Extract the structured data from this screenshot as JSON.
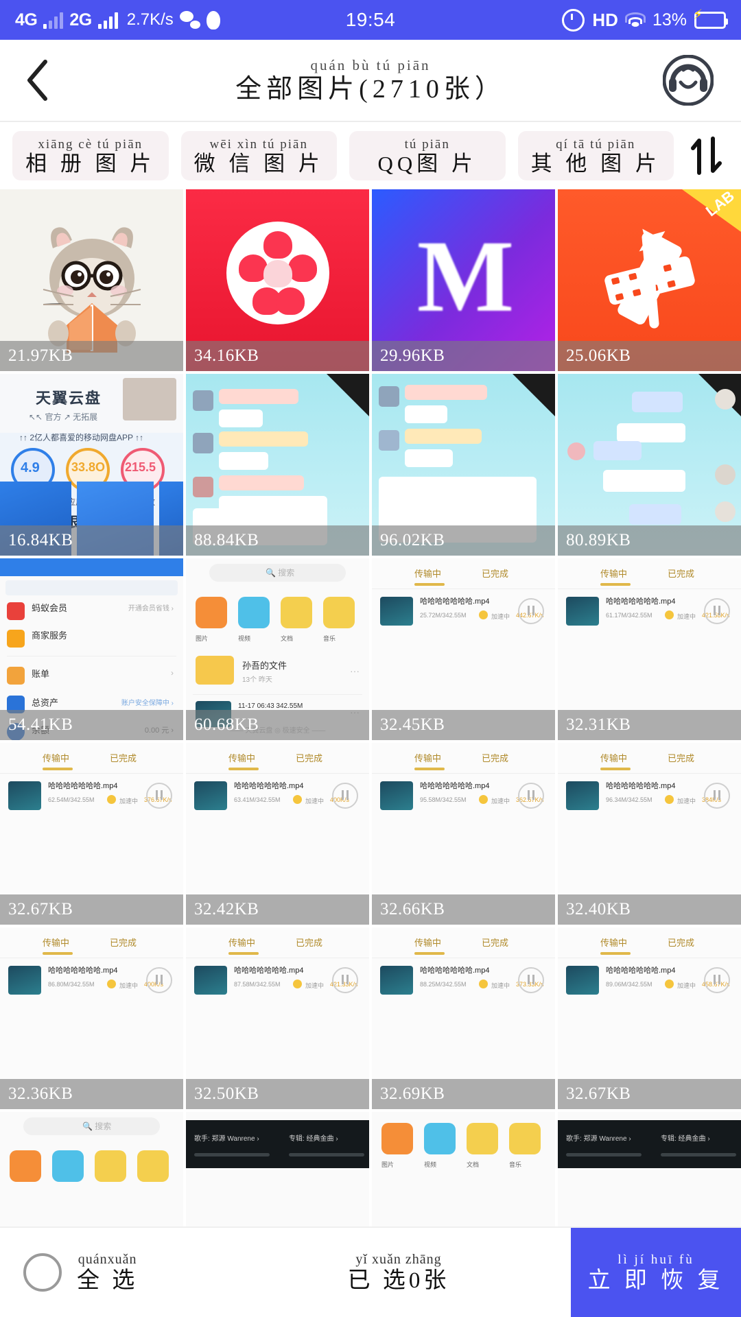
{
  "statusbar": {
    "net1": "4G",
    "net2": "2G",
    "speed": "2.7K/s",
    "wechat_icon": "wechat-icon",
    "qq_icon": "qq-icon",
    "time": "19:54",
    "alarm_icon": "alarm-icon",
    "hd": "HD",
    "wifi_icon": "wifi-icon",
    "battery_percent": "13%",
    "battery_icon": "battery-charging-icon",
    "accent": "#4b53f0"
  },
  "header": {
    "back_icon": "back-chevron-icon",
    "title_pinyin": "quán bù tú piān",
    "title_pinyin_tail": "zhāng",
    "title": "全部图片(2710张）",
    "title_hanzi_head": "全 部 图 片(2710",
    "title_hanzi_tail": "张）",
    "service_icon": "customer-service-icon",
    "count": 2710
  },
  "tabs": [
    {
      "pinyin": "xiāng cè  tú piān",
      "label": "相 册 图 片",
      "name": "album-images"
    },
    {
      "pinyin": "wēi xìn  tú piān",
      "label": "微 信 图 片",
      "name": "wechat-images"
    },
    {
      "pinyin": "tú piān",
      "label": "QQ图 片",
      "name": "qq-images"
    },
    {
      "pinyin": "qí  tā  tú piān",
      "label": "其 他 图 片",
      "name": "other-images"
    }
  ],
  "sort_icon": "sort-updown-icon",
  "grid": {
    "columns": 4,
    "items": [
      {
        "size": "21.97KB",
        "art": "hamster"
      },
      {
        "size": "34.16KB",
        "art": "kuaishou"
      },
      {
        "size": "29.96KB",
        "art": "meitu"
      },
      {
        "size": "25.06KB",
        "art": "vlab"
      },
      {
        "size": "16.84KB",
        "art": "cloud"
      },
      {
        "size": "88.84KB",
        "art": "chat"
      },
      {
        "size": "96.02KB",
        "art": "chat"
      },
      {
        "size": "80.89KB",
        "art": "chat"
      },
      {
        "size": "54.41KB",
        "art": "list"
      },
      {
        "size": "60.68KB",
        "art": "filelist"
      },
      {
        "size": "32.45KB",
        "art": "download"
      },
      {
        "size": "32.31KB",
        "art": "download"
      },
      {
        "size": "32.67KB",
        "art": "download"
      },
      {
        "size": "32.42KB",
        "art": "download"
      },
      {
        "size": "32.66KB",
        "art": "download"
      },
      {
        "size": "32.40KB",
        "art": "download"
      },
      {
        "size": "32.36KB",
        "art": "download"
      },
      {
        "size": "32.50KB",
        "art": "download"
      },
      {
        "size": "32.69KB",
        "art": "download"
      },
      {
        "size": "32.67KB",
        "art": "download"
      }
    ],
    "partial_row": [
      {
        "art": "filelist"
      },
      {
        "art": "dark"
      },
      {
        "art": "approw"
      },
      {
        "art": "dark"
      }
    ]
  },
  "bottombar": {
    "select_all_pinyin": "quánxuǎn",
    "select_all": "全 选",
    "selected_pinyin": "yǐ  xuǎn  zhāng",
    "selected": "已 选0张",
    "selected_count": 0,
    "restore_pinyin": "lì   jí  huī fù",
    "restore": "立 即 恢 复",
    "restore_color": "#4b53f0"
  }
}
